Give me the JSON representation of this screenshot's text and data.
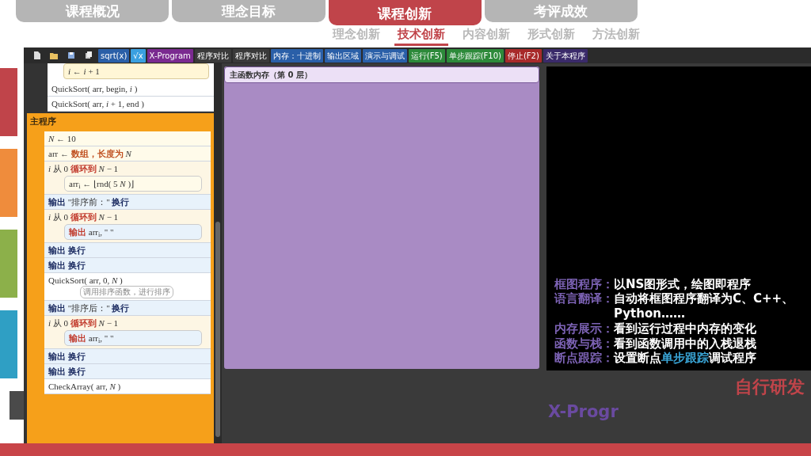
{
  "tabs": [
    {
      "label": "课程概况",
      "selected": false
    },
    {
      "label": "理念目标",
      "selected": false
    },
    {
      "label": "课程创新",
      "selected": true
    },
    {
      "label": "考评成效",
      "selected": false
    }
  ],
  "subtabs": [
    {
      "label": "理念创新",
      "selected": false
    },
    {
      "label": "技术创新",
      "selected": true
    },
    {
      "label": "内容创新",
      "selected": false
    },
    {
      "label": "形式创新",
      "selected": false
    },
    {
      "label": "方法创新",
      "selected": false
    }
  ],
  "side_markers": [
    {
      "color": "#c0444a"
    },
    {
      "color": "#ef8c3c"
    },
    {
      "color": "#8cb04a"
    },
    {
      "color": "#2f9fc4"
    },
    {
      "color": "#4a4a4a"
    }
  ],
  "toolbar": [
    {
      "kind": "button",
      "label": "sqrt(x)",
      "color": "#2a5fa8"
    },
    {
      "kind": "button",
      "label": "√x",
      "color": "#3aa0e0"
    },
    {
      "kind": "button",
      "label": "X-Program",
      "color": "#7a2a90"
    },
    {
      "kind": "button",
      "label": "程序对比",
      "color": "#3a3a3a"
    },
    {
      "kind": "button",
      "label": "程序对比",
      "color": "#3a3a3a"
    },
    {
      "kind": "button",
      "label": "内存：十进制",
      "color": "#2a5fa8"
    },
    {
      "kind": "button",
      "label": "输出区域",
      "color": "#2a5fa8"
    },
    {
      "kind": "button",
      "label": "演示与调试",
      "color": "#2a5fa8"
    },
    {
      "kind": "button",
      "label": "运行(F5)",
      "color": "#2d8a3a"
    },
    {
      "kind": "button",
      "label": "单步跟踪(F10)",
      "color": "#2d8a3a"
    },
    {
      "kind": "button",
      "label": "停止(F2)",
      "color": "#a82a2a"
    },
    {
      "kind": "button",
      "label": "关于本程序",
      "color": "#3a2a6a"
    }
  ],
  "function_tail": [
    {
      "kind": "loop_body",
      "text": "*i*  ←  *i* + 1"
    },
    {
      "kind": "call",
      "text": "QuickSort( arr,  begin,  *i* )"
    },
    {
      "kind": "call",
      "text": "QuickSort( arr,  *i* + 1,  end )"
    }
  ],
  "main_program": {
    "title": "主程序",
    "statements": [
      {
        "kind": "assign",
        "text": "*N*  ←  10"
      },
      {
        "kind": "assign",
        "text": "arr  ←  **数组，长度为**  *N*"
      },
      {
        "kind": "loop",
        "text": "*i*  从  0  **循环到**  *N* − 1",
        "body": {
          "kind": "assign",
          "text": "arr$_{i}$  ←  ⌊rnd( 5 *N* )⌋"
        }
      },
      {
        "kind": "output",
        "text": "**输出**  \"排序前：\"  **换行**"
      },
      {
        "kind": "loop",
        "text": "*i*  从  0  **循环到**  *N* − 1",
        "body": {
          "kind": "output",
          "text": "**输出**  arr$_{i}$,  \"  \""
        }
      },
      {
        "kind": "output",
        "text": "**输出**  **换行**"
      },
      {
        "kind": "output",
        "text": "**输出**  **换行**"
      },
      {
        "kind": "call",
        "text": "QuickSort( arr,  0,  *N* )",
        "comment": "调用排序函数，进行排序"
      },
      {
        "kind": "output",
        "text": "**输出**  \"排序后：\"  **换行**"
      },
      {
        "kind": "loop",
        "text": "*i*  从  0  **循环到**  *N* − 1",
        "body": {
          "kind": "output",
          "text": "**输出**  arr$_{i}$,  \"  \""
        }
      },
      {
        "kind": "output",
        "text": "**输出**  **换行**"
      },
      {
        "kind": "output",
        "text": "**输出**  **换行**"
      },
      {
        "kind": "call",
        "text": "CheckArray( arr,  *N* )"
      }
    ]
  },
  "memory_panel": {
    "title": "主函数内存（第 0 层）"
  },
  "features": [
    {
      "term": "框图程序：",
      "desc": "以NS图形式，绘图即程序"
    },
    {
      "term": "语言翻译：",
      "desc": "自动将框图程序翻译为C、C++、Python……"
    },
    {
      "term": "内存展示：",
      "desc": "看到运行过程中内存的变化"
    },
    {
      "term": "函数与栈：",
      "desc": "看到函数调用中的入栈退栈"
    },
    {
      "term": "断点跟踪：",
      "desc": "设置断点**单步跟踪**调试程序"
    }
  ],
  "tagline": "自行研发",
  "product_name": "X-Progr"
}
